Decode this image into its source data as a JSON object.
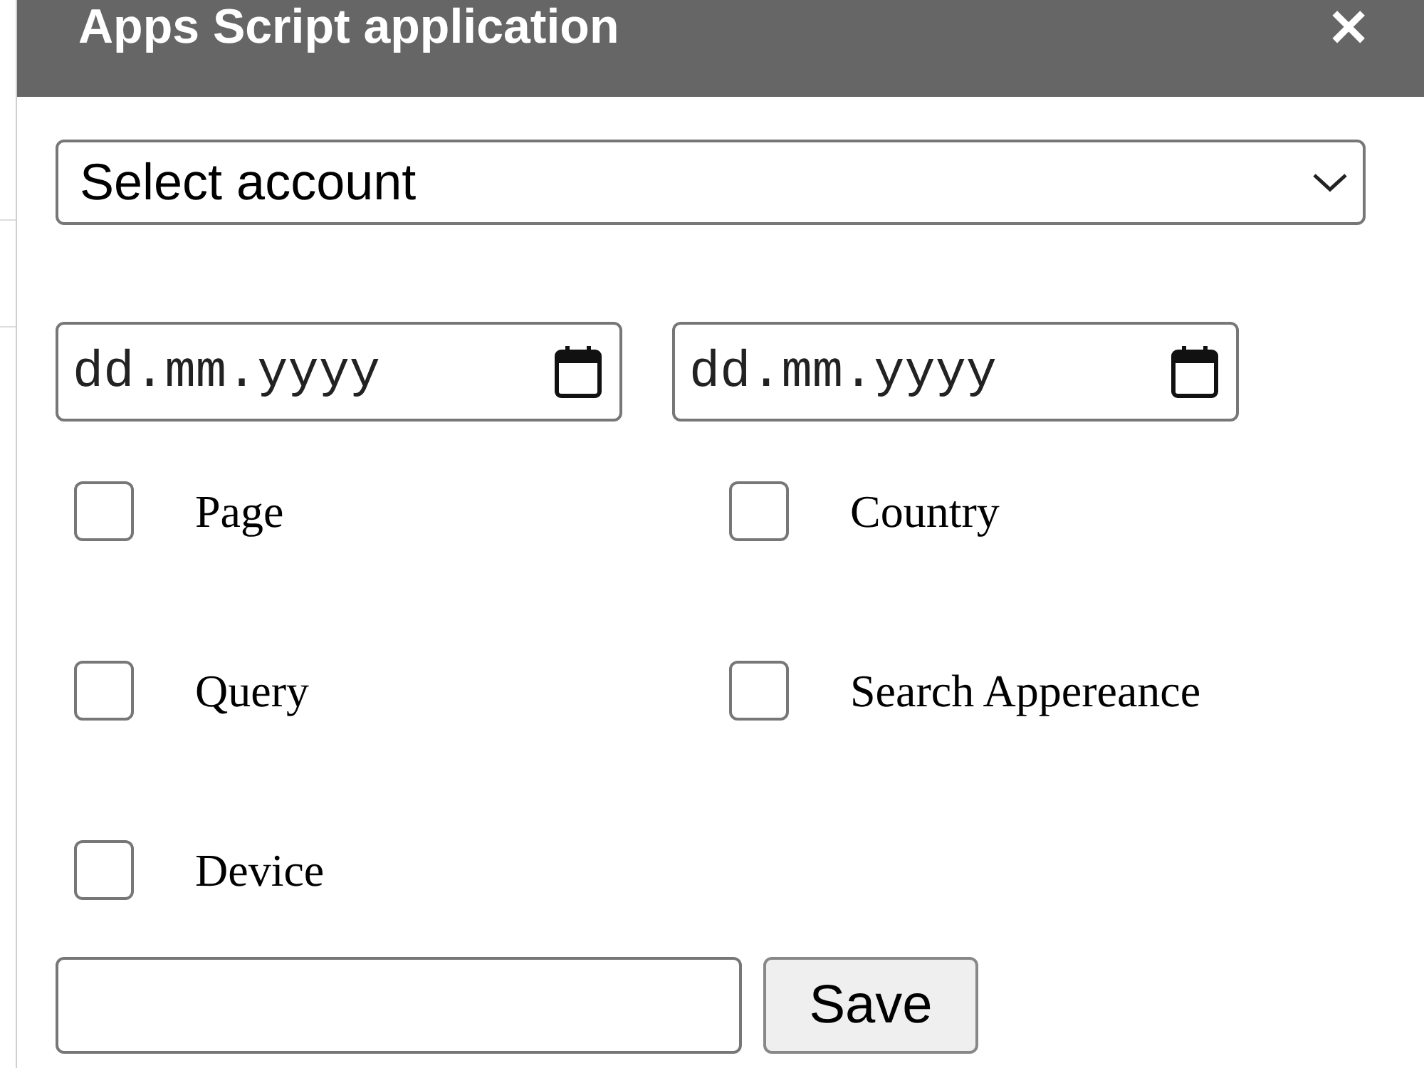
{
  "dialog": {
    "title": "Apps Script application",
    "close": "✕"
  },
  "account_select": {
    "value": "Select account"
  },
  "date_fields": [
    {
      "placeholder": "dd.mm.yyyy"
    },
    {
      "placeholder": "dd.mm.yyyy"
    }
  ],
  "checkboxes": [
    {
      "label": "Page",
      "checked": false
    },
    {
      "label": "Country",
      "checked": false
    },
    {
      "label": "Query",
      "checked": false
    },
    {
      "label": "Search Appereance",
      "checked": false
    },
    {
      "label": "Device",
      "checked": false
    }
  ],
  "save_button": {
    "label": "Save"
  }
}
